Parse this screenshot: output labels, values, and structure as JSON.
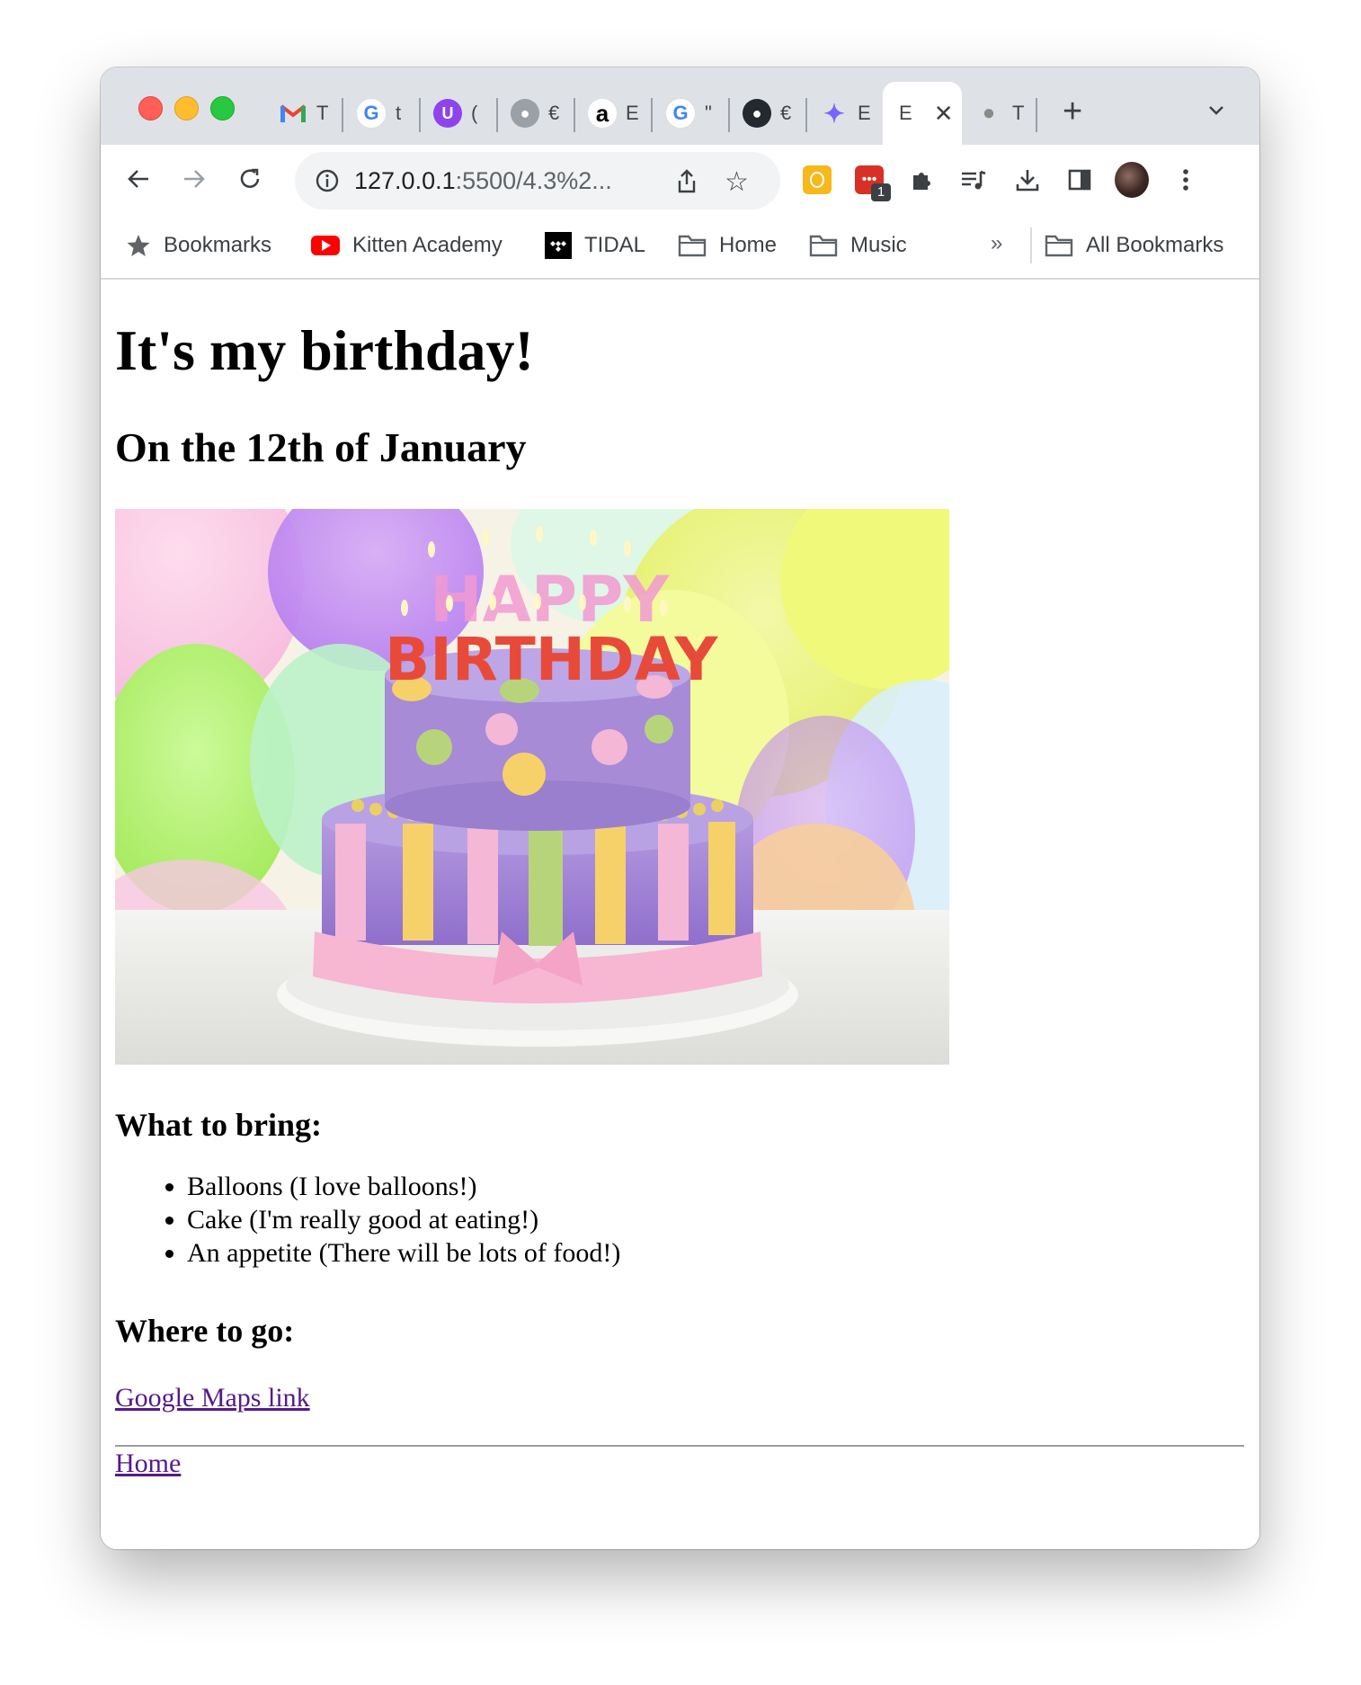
{
  "browser": {
    "tabs": [
      {
        "icon": "gmail-icon",
        "label": "T"
      },
      {
        "icon": "google-icon",
        "label": "t"
      },
      {
        "icon": "unstoppable-icon",
        "label": "("
      },
      {
        "icon": "github-icon",
        "label": "€"
      },
      {
        "icon": "amazon-icon",
        "label": "E"
      },
      {
        "icon": "google-icon",
        "label": "\""
      },
      {
        "icon": "github-icon",
        "label": "€"
      },
      {
        "icon": "gemini-icon",
        "label": "E"
      },
      {
        "icon": "page-icon",
        "label": "E",
        "active": true
      },
      {
        "icon": "apple-icon",
        "label": "T"
      }
    ],
    "url_host": "127.0.0.1",
    "url_rest": ":5500/4.3%2...",
    "extension_badge": "1"
  },
  "bookmarks": {
    "items": [
      {
        "icon": "star-icon",
        "label": "Bookmarks"
      },
      {
        "icon": "youtube-icon",
        "label": "Kitten Academy"
      },
      {
        "icon": "tidal-icon",
        "label": "TIDAL"
      },
      {
        "icon": "folder-icon",
        "label": "Home"
      },
      {
        "icon": "folder-icon",
        "label": "Music"
      }
    ],
    "overflow": "»",
    "all_bookmarks": "All Bookmarks"
  },
  "page": {
    "title": "It's my birthday!",
    "date": "On the 12th of January",
    "cake_image": {
      "letters_line1": "HAPPY",
      "letters_line2": "BIRTHDAY"
    },
    "bring_heading": "What to bring:",
    "bring_items": [
      "Balloons (I love balloons!)",
      "Cake (I'm really good at eating!)",
      "An appetite (There will be lots of food!)"
    ],
    "go_heading": "Where to go:",
    "maps_link": "Google Maps link",
    "home_link": "Home"
  },
  "colors": {
    "link": "#551a8b",
    "tabstrip": "#dee1e6",
    "omnibox": "#f1f3f4"
  }
}
